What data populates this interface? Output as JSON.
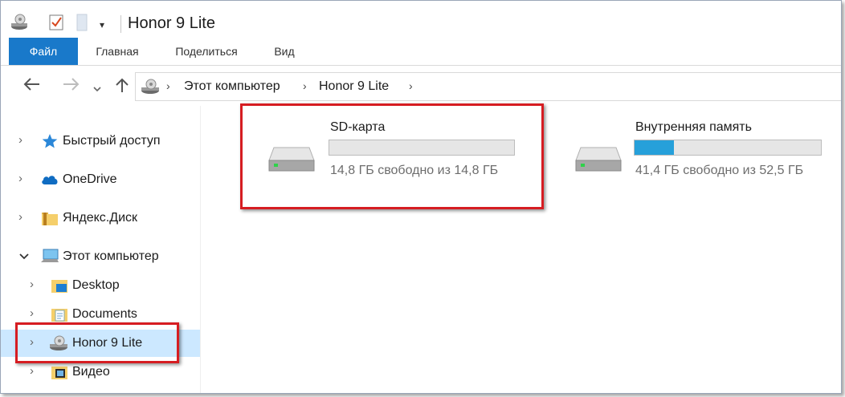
{
  "window": {
    "title": "Honor 9 Lite"
  },
  "ribbon": {
    "tabs": [
      {
        "label": "Файл"
      },
      {
        "label": "Главная"
      },
      {
        "label": "Поделиться"
      },
      {
        "label": "Вид"
      }
    ]
  },
  "address": {
    "crumbs": [
      {
        "label": "Этот компьютер"
      },
      {
        "label": "Honor 9 Lite"
      }
    ]
  },
  "nav": {
    "items": [
      {
        "label": "Быстрый доступ",
        "icon": "star-icon",
        "expanded": false
      },
      {
        "label": "OneDrive",
        "icon": "cloud-icon",
        "expanded": false
      },
      {
        "label": "Яндекс.Диск",
        "icon": "folder-icon",
        "expanded": false
      },
      {
        "label": "Этот компьютер",
        "icon": "computer-icon",
        "expanded": true
      },
      {
        "label": "Desktop",
        "icon": "desktop-folder-icon",
        "expanded": false
      },
      {
        "label": "Documents",
        "icon": "documents-folder-icon",
        "expanded": false
      },
      {
        "label": "Honor 9 Lite",
        "icon": "phone-drive-icon",
        "expanded": false,
        "selected": true
      },
      {
        "label": "Видео",
        "icon": "video-folder-icon",
        "expanded": false
      }
    ]
  },
  "drives": [
    {
      "name": "SD-карта",
      "free_text": "14,8 ГБ свободно из 14,8 ГБ",
      "used_fraction": 0.0
    },
    {
      "name": "Внутренняя память",
      "free_text": "41,4 ГБ свободно из 52,5 ГБ",
      "used_fraction": 0.21
    }
  ],
  "colors": {
    "accent": "#1979ca",
    "selection": "#cce8ff",
    "highlight_box": "#d61d22",
    "usage_bar": "#26a0da"
  }
}
